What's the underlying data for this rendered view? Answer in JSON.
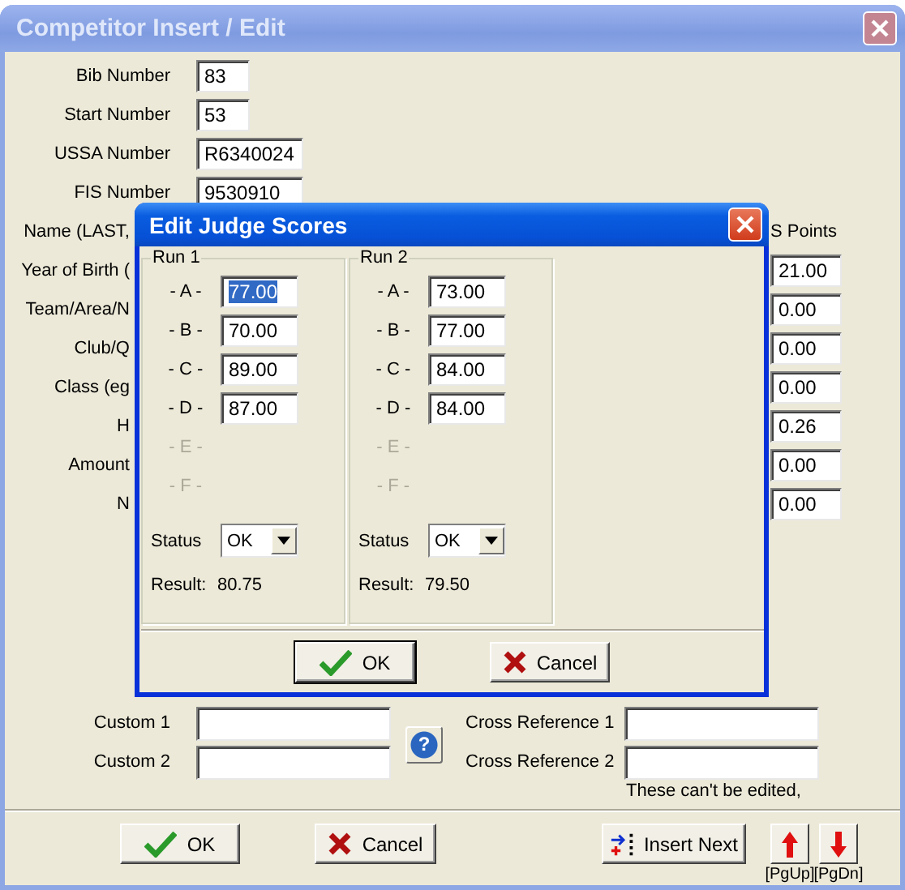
{
  "window": {
    "title": "Competitor Insert / Edit",
    "active": false
  },
  "fields": [
    {
      "kind": "field",
      "label": "Bib Number",
      "value": "83"
    },
    {
      "kind": "field",
      "label": "Start Number",
      "value": "53"
    },
    {
      "kind": "field",
      "label": "USSA Number",
      "value": "R6340024"
    },
    {
      "kind": "field",
      "label": "FIS Number",
      "value": "9530910"
    },
    {
      "kind": "label",
      "label": "Name (LAST,"
    },
    {
      "kind": "label",
      "label": "Year of Birth ("
    },
    {
      "kind": "label",
      "label": "Team/Area/N"
    },
    {
      "kind": "label",
      "label": "Club/Q"
    },
    {
      "kind": "label",
      "label": "Class (eg"
    },
    {
      "kind": "label",
      "label": "H"
    },
    {
      "kind": "label",
      "label": "Amount"
    },
    {
      "kind": "label",
      "label": "N"
    }
  ],
  "points": {
    "label": "S Points",
    "values": [
      "21.00",
      "0.00",
      "0.00",
      "0.00",
      "0.26",
      "0.00",
      "0.00"
    ]
  },
  "custom": [
    {
      "label": "Custom 1"
    },
    {
      "label": "Custom 2"
    }
  ],
  "help_button": {
    "label": "?"
  },
  "cross_references": [
    {
      "label": "Cross Reference 1"
    },
    {
      "label": "Cross Reference 2"
    }
  ],
  "note": "These can't be edited,",
  "buttons": [
    {
      "kind": "ok",
      "label": "OK"
    },
    {
      "kind": "cancel",
      "label": "Cancel"
    },
    {
      "kind": "insert",
      "label": "Insert Next"
    }
  ],
  "page_buttons": [
    {
      "kind": "up",
      "label": "[PgUp]"
    },
    {
      "kind": "down",
      "label": "[PgDn]"
    }
  ],
  "dialog": {
    "title": "Edit Judge Scores",
    "active": true,
    "runs": [
      {
        "title": "Run 1",
        "judges": [
          {
            "label": "- A -",
            "value": "77.00",
            "disabled": false,
            "selected": true
          },
          {
            "label": "- B -",
            "value": "70.00",
            "disabled": false,
            "selected": false
          },
          {
            "label": "- C -",
            "value": "89.00",
            "disabled": false,
            "selected": false
          },
          {
            "label": "- D -",
            "value": "87.00",
            "disabled": false,
            "selected": false
          },
          {
            "label": "- E -",
            "disabled": true
          },
          {
            "label": "- F -",
            "disabled": true
          }
        ],
        "status_label": "Status",
        "status": "OK",
        "result_label": "Result:",
        "result": "80.75"
      },
      {
        "title": "Run 2",
        "judges": [
          {
            "label": "- A -",
            "value": "73.00",
            "disabled": false,
            "selected": false
          },
          {
            "label": "- B -",
            "value": "77.00",
            "disabled": false,
            "selected": false
          },
          {
            "label": "- C -",
            "value": "84.00",
            "disabled": false,
            "selected": false
          },
          {
            "label": "- D -",
            "value": "84.00",
            "disabled": false,
            "selected": false
          },
          {
            "label": "- E -",
            "disabled": true
          },
          {
            "label": "- F -",
            "disabled": true
          }
        ],
        "status_label": "Status",
        "status": "OK",
        "result_label": "Result:",
        "result": "79.50"
      }
    ],
    "buttons": [
      {
        "kind": "ok",
        "label": "OK"
      },
      {
        "kind": "cancel",
        "label": "Cancel"
      }
    ]
  }
}
